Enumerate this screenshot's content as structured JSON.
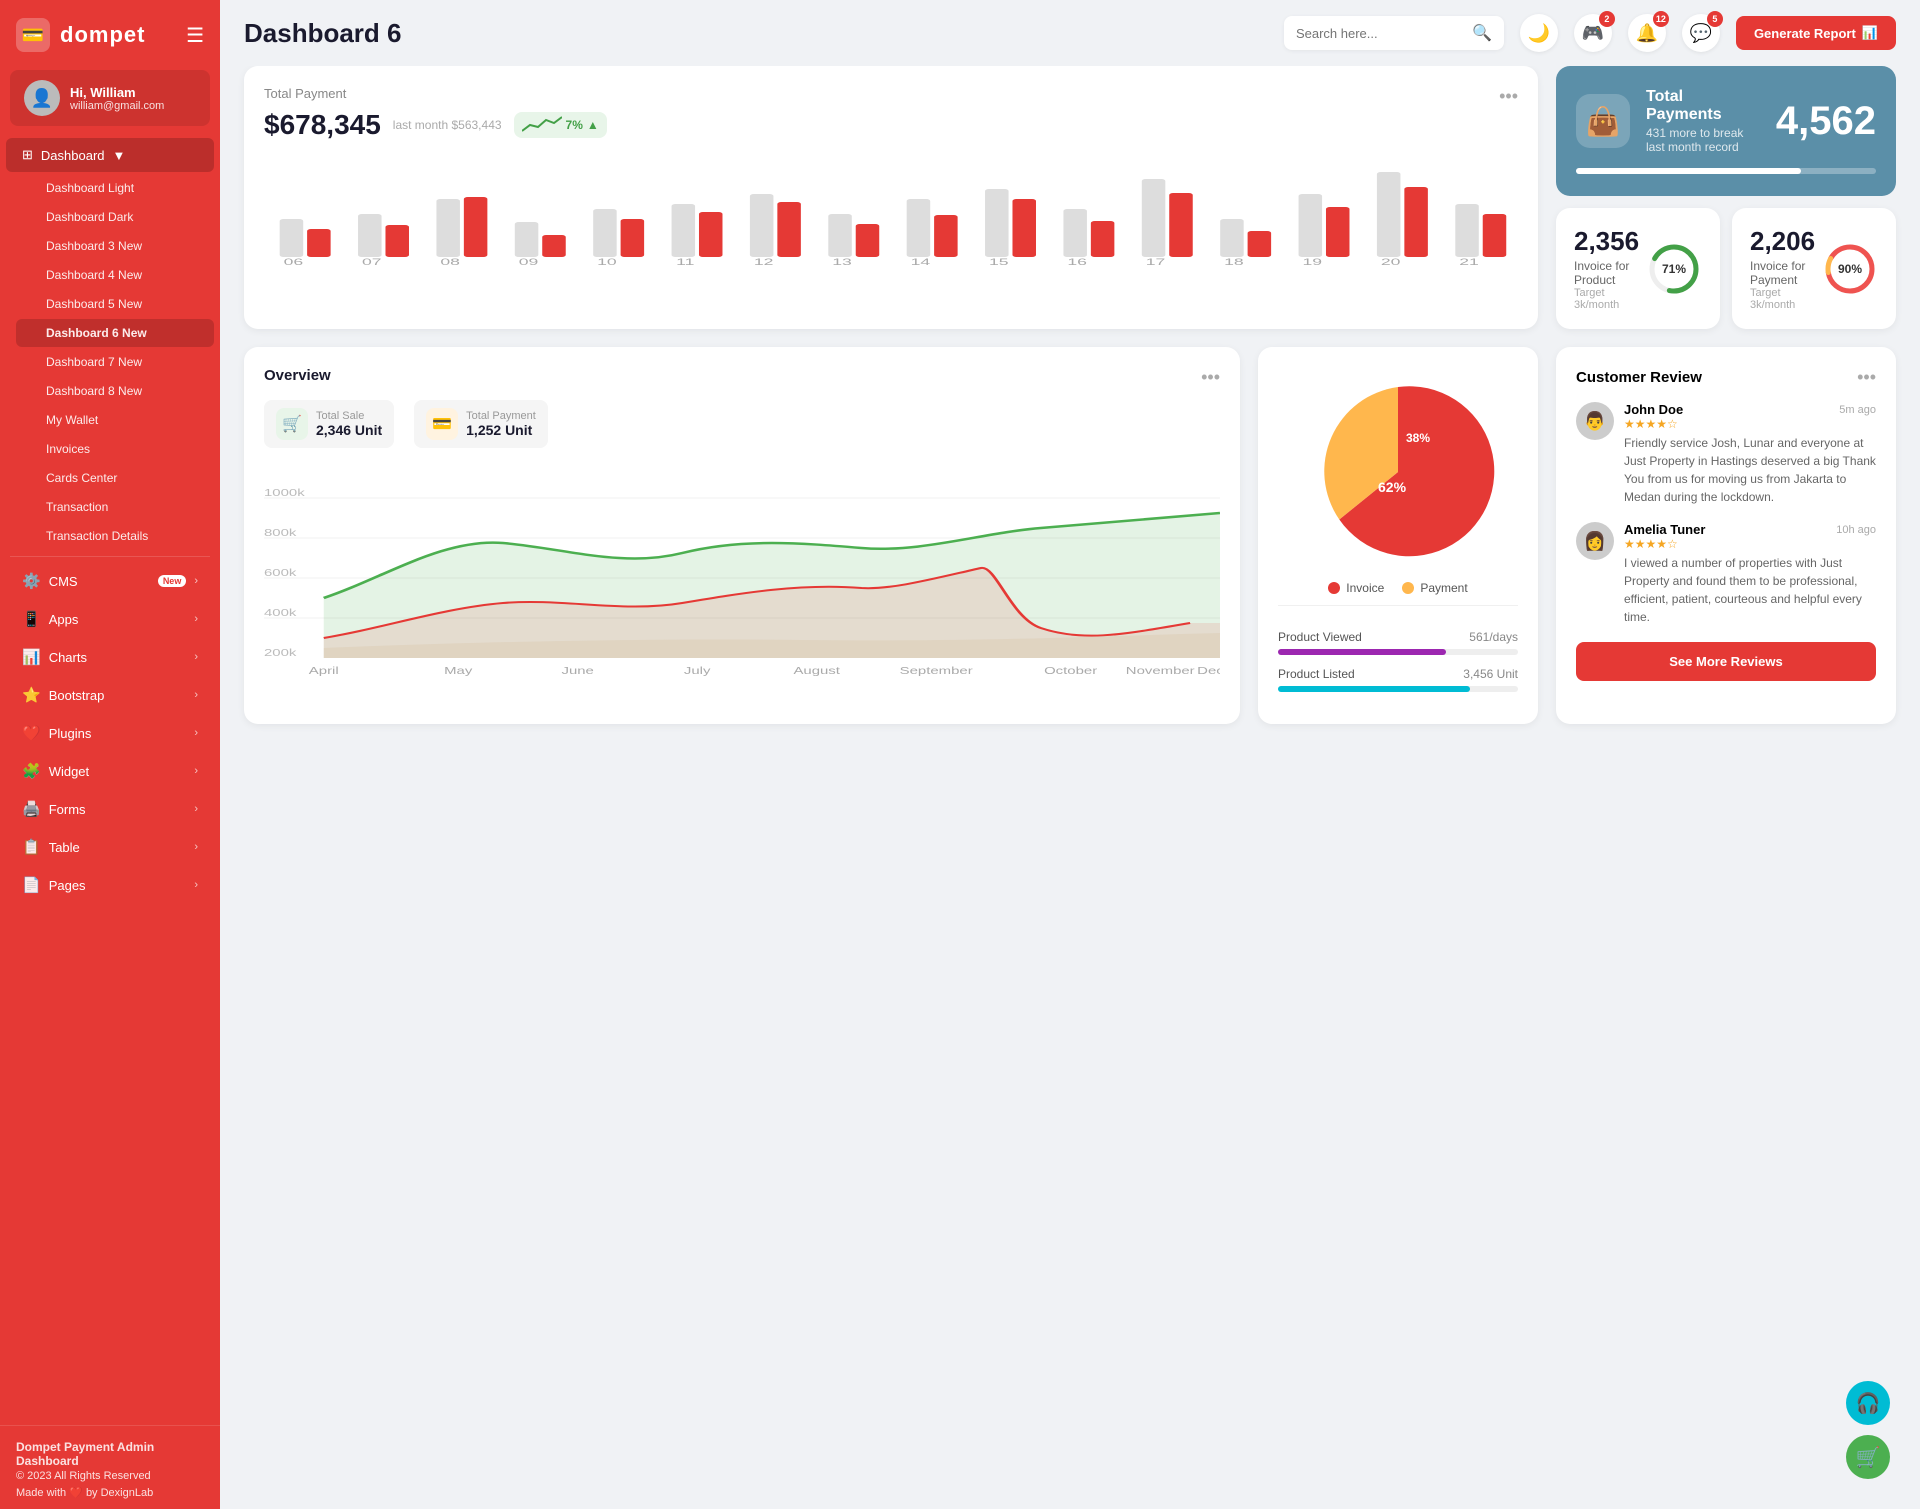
{
  "app": {
    "name": "dompet",
    "logo_icon": "💳"
  },
  "user": {
    "greeting": "Hi, William",
    "email": "william@gmail.com",
    "avatar": "👤"
  },
  "header": {
    "title": "Dashboard 6",
    "search_placeholder": "Search here...",
    "generate_btn": "Generate Report",
    "notifications": [
      {
        "icon": "🎮",
        "count": "2"
      },
      {
        "icon": "🔔",
        "count": "12"
      },
      {
        "icon": "💬",
        "count": "5"
      }
    ]
  },
  "sidebar": {
    "dashboard_label": "Dashboard",
    "submenu": [
      {
        "label": "Dashboard Light",
        "id": "dashboard-light",
        "badge": ""
      },
      {
        "label": "Dashboard Dark",
        "id": "dashboard-dark",
        "badge": ""
      },
      {
        "label": "Dashboard 3",
        "id": "dashboard-3",
        "badge": "New"
      },
      {
        "label": "Dashboard 4",
        "id": "dashboard-4",
        "badge": "New"
      },
      {
        "label": "Dashboard 5",
        "id": "dashboard-5",
        "badge": "New"
      },
      {
        "label": "Dashboard 6",
        "id": "dashboard-6",
        "badge": "New",
        "active": true
      },
      {
        "label": "Dashboard 7",
        "id": "dashboard-7",
        "badge": "New"
      },
      {
        "label": "Dashboard 8",
        "id": "dashboard-8",
        "badge": "New"
      },
      {
        "label": "My Wallet",
        "id": "my-wallet",
        "badge": ""
      },
      {
        "label": "Invoices",
        "id": "invoices",
        "badge": ""
      },
      {
        "label": "Cards Center",
        "id": "cards-center",
        "badge": ""
      },
      {
        "label": "Transaction",
        "id": "transaction",
        "badge": ""
      },
      {
        "label": "Transaction Details",
        "id": "transaction-details",
        "badge": ""
      }
    ],
    "menu_items": [
      {
        "label": "CMS",
        "icon": "⚙️",
        "badge": "New",
        "arrow": true
      },
      {
        "label": "Apps",
        "icon": "📱",
        "badge": "",
        "arrow": true
      },
      {
        "label": "Charts",
        "icon": "📊",
        "badge": "",
        "arrow": true
      },
      {
        "label": "Bootstrap",
        "icon": "⭐",
        "badge": "",
        "arrow": true
      },
      {
        "label": "Plugins",
        "icon": "❤️",
        "badge": "",
        "arrow": true
      },
      {
        "label": "Widget",
        "icon": "🧩",
        "badge": "",
        "arrow": true
      },
      {
        "label": "Forms",
        "icon": "🖨️",
        "badge": "",
        "arrow": true
      },
      {
        "label": "Table",
        "icon": "📋",
        "badge": "",
        "arrow": true
      },
      {
        "label": "Pages",
        "icon": "📄",
        "badge": "",
        "arrow": true
      }
    ]
  },
  "total_payment": {
    "title": "Total Payment",
    "amount": "$678,345",
    "last_month": "last month $563,443",
    "trend_pct": "7%",
    "bars": [
      {
        "label": "06",
        "light": 45,
        "dark": 25
      },
      {
        "label": "07",
        "light": 50,
        "dark": 30
      },
      {
        "label": "08",
        "light": 65,
        "dark": 60
      },
      {
        "label": "09",
        "light": 40,
        "dark": 20
      },
      {
        "label": "10",
        "light": 55,
        "dark": 35
      },
      {
        "label": "11",
        "light": 60,
        "dark": 45
      },
      {
        "label": "12",
        "light": 70,
        "dark": 55
      },
      {
        "label": "13",
        "light": 50,
        "dark": 30
      },
      {
        "label": "14",
        "light": 65,
        "dark": 40
      },
      {
        "label": "15",
        "light": 75,
        "dark": 60
      },
      {
        "label": "16",
        "light": 55,
        "dark": 35
      },
      {
        "label": "17",
        "light": 80,
        "dark": 65
      },
      {
        "label": "18",
        "light": 45,
        "dark": 28
      },
      {
        "label": "19",
        "light": 70,
        "dark": 50
      },
      {
        "label": "20",
        "light": 85,
        "dark": 70
      },
      {
        "label": "21",
        "light": 60,
        "dark": 45
      }
    ]
  },
  "total_payments_blue": {
    "title": "Total Payments",
    "subtitle": "431 more to break last month record",
    "count": "4,562",
    "progress": 75
  },
  "invoice_product": {
    "count": "2,356",
    "label": "Invoice for Product",
    "sublabel": "Target 3k/month",
    "pct": "71%",
    "pct_num": 71,
    "color": "#43a047"
  },
  "invoice_payment": {
    "count": "2,206",
    "label": "Invoice for Payment",
    "sublabel": "Target 3k/month",
    "pct": "90%",
    "pct_num": 90,
    "color": "#ef5350"
  },
  "overview": {
    "title": "Overview",
    "total_sale_label": "Total Sale",
    "total_sale_value": "2,346 Unit",
    "total_payment_label": "Total Payment",
    "total_payment_value": "1,252 Unit"
  },
  "pie_chart": {
    "invoice_pct": 62,
    "payment_pct": 38,
    "invoice_label": "Invoice",
    "payment_label": "Payment",
    "invoice_color": "#e53935",
    "payment_color": "#ffb74d"
  },
  "product_stats": {
    "viewed_label": "Product Viewed",
    "viewed_value": "561/days",
    "viewed_progress": 70,
    "viewed_color": "#9c27b0",
    "listed_label": "Product Listed",
    "listed_value": "3,456 Unit",
    "listed_progress": 80,
    "listed_color": "#00bcd4"
  },
  "customer_review": {
    "title": "Customer Review",
    "reviews": [
      {
        "name": "John Doe",
        "stars": 4,
        "time": "5m ago",
        "text": "Friendly service Josh, Lunar and everyone at Just Property in Hastings deserved a big Thank You from us for moving us from Jakarta to Medan during the lockdown.",
        "avatar": "👨"
      },
      {
        "name": "Amelia Tuner",
        "stars": 4,
        "time": "10h ago",
        "text": "I viewed a number of properties with Just Property and found them to be professional, efficient, patient, courteous and helpful every time.",
        "avatar": "👩"
      }
    ],
    "see_more_btn": "See More Reviews"
  },
  "footer": {
    "title": "Dompet Payment Admin Dashboard",
    "copy": "© 2023 All Rights Reserved",
    "made": "Made with ❤️ by DexignLab"
  }
}
